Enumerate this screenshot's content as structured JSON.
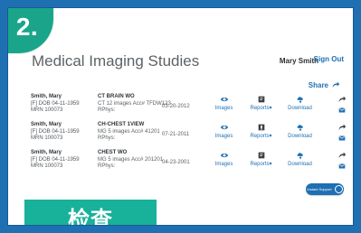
{
  "badge": "2.",
  "page": {
    "title": "Medical Imaging Studies",
    "user": "Mary Smith",
    "sign_out": "Sign Out",
    "share": "Share"
  },
  "actions": {
    "images": "Images",
    "reports": "Reports",
    "download": "Download"
  },
  "studies": [
    {
      "patient_name": "Smith, Mary",
      "patient_line2": "[F] DOB 04-11-1959",
      "patient_line3": "MRN 100073",
      "study_title": "CT BRAIN WO",
      "study_line2": "CT 12 images  Acc# TFDW123",
      "study_line3": "RPhys:",
      "date": "03-20-2012"
    },
    {
      "patient_name": "Smith, Mary",
      "patient_line2": "[F] DOB 04-11-1959",
      "patient_line3": "MRN 100073",
      "study_title": "CH-CHEST 1VIEW",
      "study_line2": "MG 5 images  Acc# 41201",
      "study_line3": "RPhys:",
      "date": "07-21-2011"
    },
    {
      "patient_name": "Smith, Mary",
      "patient_line2": "[F] DOB 04-11-1959",
      "patient_line3": "MRN 100073",
      "study_title": "CHEST WO",
      "study_line2": "MG 5 images  Acc# 201201",
      "study_line3": "RPhys:",
      "date": "04-23-2001"
    }
  ],
  "support": "Instant Support",
  "bottom_tag": "检查"
}
